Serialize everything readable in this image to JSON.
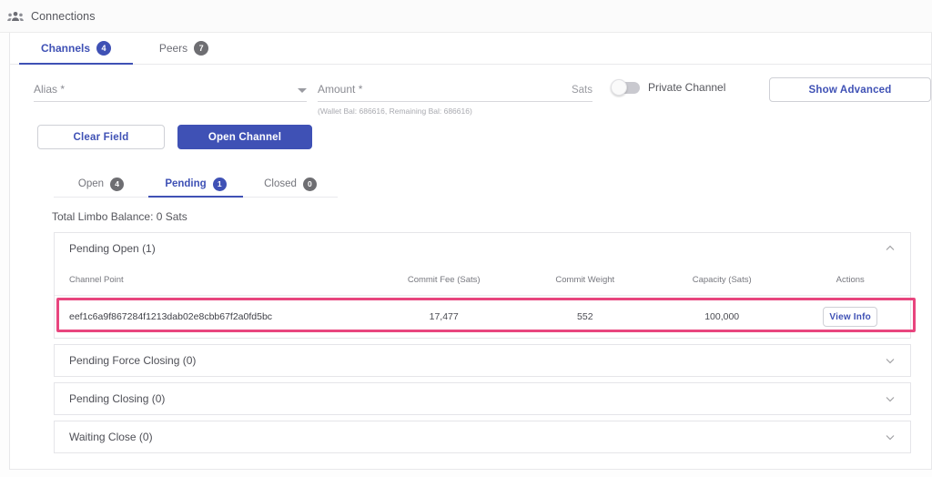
{
  "header": {
    "icon": "people-group-icon",
    "title": "Connections"
  },
  "tabs": [
    {
      "label": "Channels",
      "count": "4",
      "active": true
    },
    {
      "label": "Peers",
      "count": "7",
      "active": false
    }
  ],
  "form": {
    "alias": {
      "label": "Alias *",
      "value": "",
      "placeholder": "Alias *",
      "icon": "chevron-down-icon"
    },
    "amount": {
      "label": "Amount *",
      "value": "",
      "placeholder": "Amount *",
      "suffix": "Sats",
      "help": "(Wallet Bal: 686616, Remaining Bal: 686616)"
    },
    "private_channel": {
      "label": "Private Channel",
      "state": "off"
    },
    "show_advanced": "Show Advanced",
    "clear_field": "Clear Field",
    "open_channel": "Open Channel"
  },
  "inner_tabs": [
    {
      "label": "Open",
      "count": "4",
      "active": false
    },
    {
      "label": "Pending",
      "count": "1",
      "active": true
    },
    {
      "label": "Closed",
      "count": "0",
      "active": false
    }
  ],
  "limbo_balance": "Total Limbo Balance: 0 Sats",
  "panels": [
    {
      "title": "Pending Open (1)",
      "expanded": true,
      "icon": "chevron-up-icon"
    },
    {
      "title": "Pending Force Closing (0)",
      "expanded": false,
      "icon": "chevron-down-icon"
    },
    {
      "title": "Pending Closing (0)",
      "expanded": false,
      "icon": "chevron-down-icon"
    },
    {
      "title": "Waiting Close (0)",
      "expanded": false,
      "icon": "chevron-down-icon"
    }
  ],
  "table": {
    "columns": [
      "Channel Point",
      "Commit Fee (Sats)",
      "Commit Weight",
      "Capacity (Sats)",
      "Actions"
    ],
    "rows": [
      {
        "channel_point": "eef1c6a9f867284f1213dab02e8cbb67f2a0fd5bc",
        "commit_fee": "17,477",
        "commit_weight": "552",
        "capacity": "100,000",
        "action_label": "View Info"
      }
    ]
  },
  "colors": {
    "accent": "#3f51b5",
    "highlight": "#e8457e",
    "badge_gray": "#6e6e72",
    "text": "#4e4f56"
  }
}
